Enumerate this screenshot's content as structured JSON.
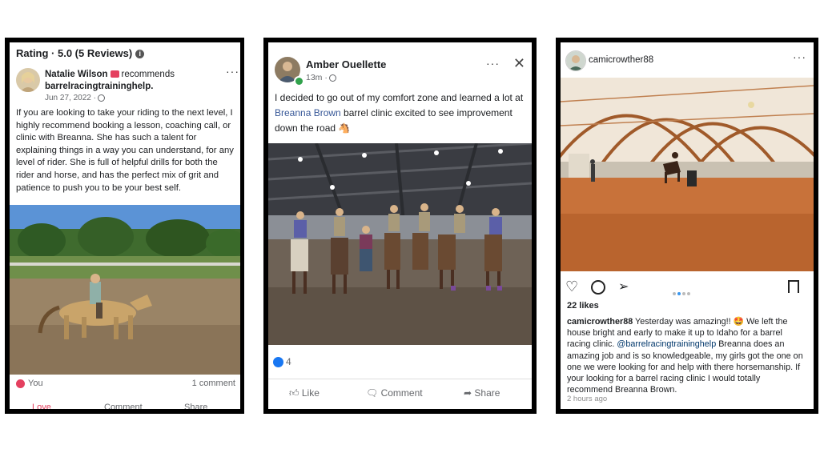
{
  "review": {
    "rating_label": "Rating · 5.0 (5 Reviews)",
    "author": "Natalie Wilson",
    "recommends": "recommends",
    "page": "barrelracingtraininghelp.",
    "date": "Jun 27, 2022 ·",
    "body": "If you are looking to take your riding to the next level, I highly recommend booking a lesson, coaching call, or clinic with Breanna. She has such a talent for explaining things in a way you can understand, for any level of rider. She is full of helpful drills for both the rider and horse, and has the perfect mix of grit and patience to push you to be your best self.",
    "reaction_label": "You",
    "comment_count": "1 comment",
    "actions": [
      "Love",
      "Comment",
      "Share"
    ]
  },
  "fb_post": {
    "author": "Amber Ouellette",
    "time": "13m ·",
    "text_before": "I decided to go out of my comfort zone and learned a lot at",
    "link": "Breanna Brown",
    "text_after": " barrel clinic excited to see improvement down the road",
    "like_count": "4",
    "actions": [
      "Like",
      "Comment",
      "Share"
    ]
  },
  "ig_post": {
    "username": "camicrowther88",
    "likes": "22 likes",
    "caption_user": "camicrowther88",
    "caption_1": " Yesterday was amazing!! ",
    "caption_2": " We left the house bright and early to make it up to Idaho for a barrel racing clinic. ",
    "mention": "@barrelracingtraininghelp",
    "caption_3": " Breanna does an amazing job and is so knowledgeable, my girls got the one on one we were looking for and help with there horsemanship. If your looking for a barrel racing clinic I would totally recommend Breanna Brown.",
    "time": "2 hours ago"
  },
  "colors": {
    "fb_blue": "#1877f2",
    "link": "#385898",
    "love": "#e4405f"
  }
}
